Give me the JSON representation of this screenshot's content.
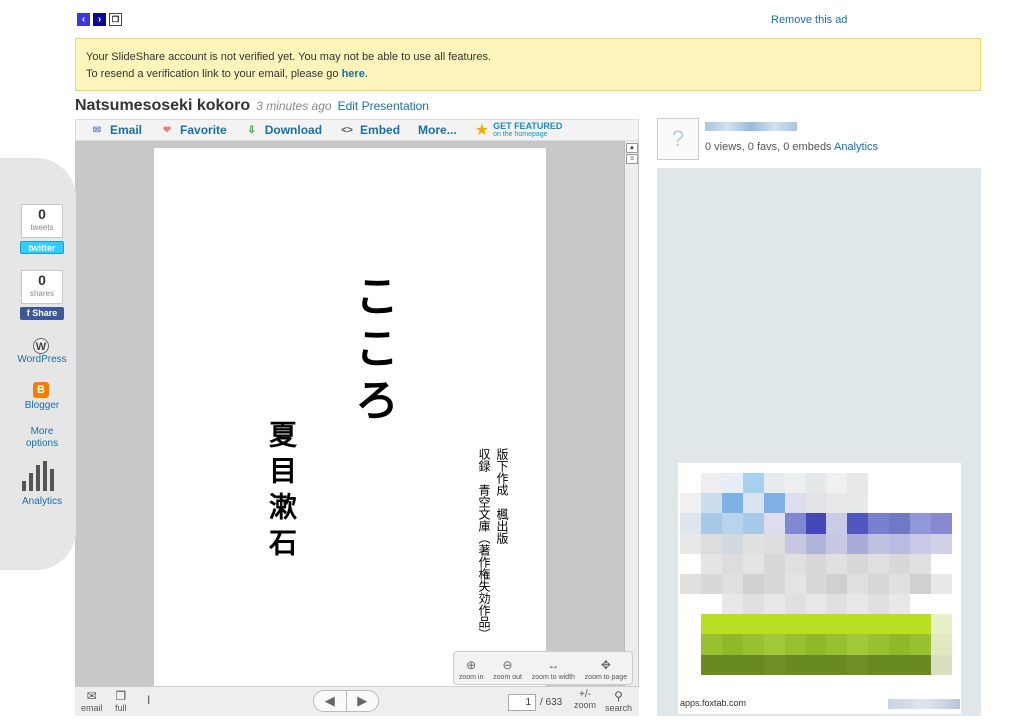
{
  "top": {
    "nav_prev_icon": "chevron-left",
    "nav_next_icon": "chevron-right",
    "nav_window_icon": "popout-window",
    "remove_ad": "Remove this ad"
  },
  "notice": {
    "line1": "Your SlideShare account is not verified yet. You may not be able to use all features.",
    "line2_prefix": "To resend a verification link to your email, please go ",
    "line2_link": "here",
    "line2_suffix": "."
  },
  "presentation": {
    "title": "Natsumesoseki kokoro",
    "time": "3 minutes ago",
    "edit": "Edit Presentation"
  },
  "toolbar": {
    "email": "Email",
    "favorite": "Favorite",
    "download": "Download",
    "embed": "Embed",
    "more": "More...",
    "featured_line1": "GET FEATURED",
    "featured_line2": "on the homepage"
  },
  "slide": {
    "title": "こころ",
    "author": "夏目漱石",
    "note1": "版下作成　楓出版",
    "note2": "収録　青空文庫（著作権失効作品）"
  },
  "zoom": {
    "in": "zoom in",
    "out": "zoom out",
    "width": "zoom to width",
    "page": "zoom to page"
  },
  "bottombar": {
    "email": "email",
    "full": "full",
    "page_current": "1",
    "page_total": "/ 633",
    "zoom_label": "zoom",
    "zoom_symbol": "+/-",
    "search": "search"
  },
  "share": {
    "tweets_count": "0",
    "tweets_label": "tweets",
    "twitter_badge": "twitter",
    "shares_count": "0",
    "shares_label": "shares",
    "facebook_badge": "f Share",
    "wordpress": "WordPress",
    "blogger": "Blogger",
    "more_options_line1": "More",
    "more_options_line2": "options",
    "analytics": "Analytics"
  },
  "profile": {
    "avatar_symbol": "?",
    "stats": "0 views, 0 favs, 0 embeds",
    "analytics_link": "Analytics"
  },
  "ad": {
    "source": "apps.foxtab.com"
  },
  "colors": {
    "link": "#1a6fa8",
    "notice_bg": "#fcf5bb",
    "notice_border": "#e8d868",
    "ad_panel": "#dfe7ea"
  }
}
